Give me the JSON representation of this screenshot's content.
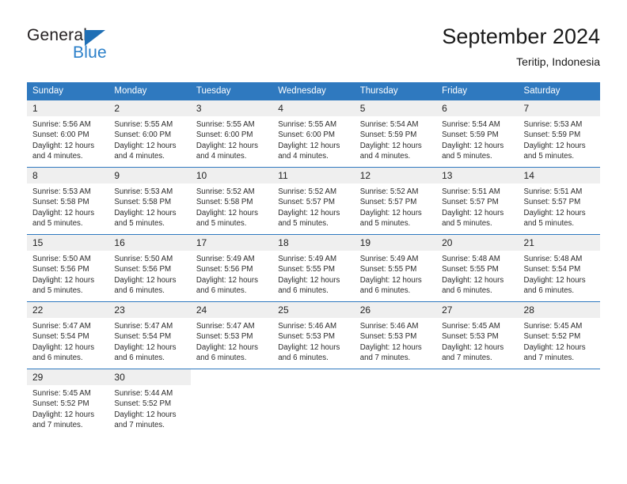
{
  "brand": {
    "name_part1": "General",
    "name_part2": "Blue"
  },
  "header": {
    "title": "September 2024",
    "subtitle": "Teritip, Indonesia"
  },
  "colors": {
    "header_blue": "#2f79bf",
    "daynum_bg": "#efefef",
    "logo_blue": "#2a7fc9",
    "text": "#2b2b2b"
  },
  "weekdays": [
    "Sunday",
    "Monday",
    "Tuesday",
    "Wednesday",
    "Thursday",
    "Friday",
    "Saturday"
  ],
  "weeks": [
    [
      {
        "day": "1",
        "sunrise": "Sunrise: 5:56 AM",
        "sunset": "Sunset: 6:00 PM",
        "daylight1": "Daylight: 12 hours",
        "daylight2": "and 4 minutes."
      },
      {
        "day": "2",
        "sunrise": "Sunrise: 5:55 AM",
        "sunset": "Sunset: 6:00 PM",
        "daylight1": "Daylight: 12 hours",
        "daylight2": "and 4 minutes."
      },
      {
        "day": "3",
        "sunrise": "Sunrise: 5:55 AM",
        "sunset": "Sunset: 6:00 PM",
        "daylight1": "Daylight: 12 hours",
        "daylight2": "and 4 minutes."
      },
      {
        "day": "4",
        "sunrise": "Sunrise: 5:55 AM",
        "sunset": "Sunset: 6:00 PM",
        "daylight1": "Daylight: 12 hours",
        "daylight2": "and 4 minutes."
      },
      {
        "day": "5",
        "sunrise": "Sunrise: 5:54 AM",
        "sunset": "Sunset: 5:59 PM",
        "daylight1": "Daylight: 12 hours",
        "daylight2": "and 4 minutes."
      },
      {
        "day": "6",
        "sunrise": "Sunrise: 5:54 AM",
        "sunset": "Sunset: 5:59 PM",
        "daylight1": "Daylight: 12 hours",
        "daylight2": "and 5 minutes."
      },
      {
        "day": "7",
        "sunrise": "Sunrise: 5:53 AM",
        "sunset": "Sunset: 5:59 PM",
        "daylight1": "Daylight: 12 hours",
        "daylight2": "and 5 minutes."
      }
    ],
    [
      {
        "day": "8",
        "sunrise": "Sunrise: 5:53 AM",
        "sunset": "Sunset: 5:58 PM",
        "daylight1": "Daylight: 12 hours",
        "daylight2": "and 5 minutes."
      },
      {
        "day": "9",
        "sunrise": "Sunrise: 5:53 AM",
        "sunset": "Sunset: 5:58 PM",
        "daylight1": "Daylight: 12 hours",
        "daylight2": "and 5 minutes."
      },
      {
        "day": "10",
        "sunrise": "Sunrise: 5:52 AM",
        "sunset": "Sunset: 5:58 PM",
        "daylight1": "Daylight: 12 hours",
        "daylight2": "and 5 minutes."
      },
      {
        "day": "11",
        "sunrise": "Sunrise: 5:52 AM",
        "sunset": "Sunset: 5:57 PM",
        "daylight1": "Daylight: 12 hours",
        "daylight2": "and 5 minutes."
      },
      {
        "day": "12",
        "sunrise": "Sunrise: 5:52 AM",
        "sunset": "Sunset: 5:57 PM",
        "daylight1": "Daylight: 12 hours",
        "daylight2": "and 5 minutes."
      },
      {
        "day": "13",
        "sunrise": "Sunrise: 5:51 AM",
        "sunset": "Sunset: 5:57 PM",
        "daylight1": "Daylight: 12 hours",
        "daylight2": "and 5 minutes."
      },
      {
        "day": "14",
        "sunrise": "Sunrise: 5:51 AM",
        "sunset": "Sunset: 5:57 PM",
        "daylight1": "Daylight: 12 hours",
        "daylight2": "and 5 minutes."
      }
    ],
    [
      {
        "day": "15",
        "sunrise": "Sunrise: 5:50 AM",
        "sunset": "Sunset: 5:56 PM",
        "daylight1": "Daylight: 12 hours",
        "daylight2": "and 5 minutes."
      },
      {
        "day": "16",
        "sunrise": "Sunrise: 5:50 AM",
        "sunset": "Sunset: 5:56 PM",
        "daylight1": "Daylight: 12 hours",
        "daylight2": "and 6 minutes."
      },
      {
        "day": "17",
        "sunrise": "Sunrise: 5:49 AM",
        "sunset": "Sunset: 5:56 PM",
        "daylight1": "Daylight: 12 hours",
        "daylight2": "and 6 minutes."
      },
      {
        "day": "18",
        "sunrise": "Sunrise: 5:49 AM",
        "sunset": "Sunset: 5:55 PM",
        "daylight1": "Daylight: 12 hours",
        "daylight2": "and 6 minutes."
      },
      {
        "day": "19",
        "sunrise": "Sunrise: 5:49 AM",
        "sunset": "Sunset: 5:55 PM",
        "daylight1": "Daylight: 12 hours",
        "daylight2": "and 6 minutes."
      },
      {
        "day": "20",
        "sunrise": "Sunrise: 5:48 AM",
        "sunset": "Sunset: 5:55 PM",
        "daylight1": "Daylight: 12 hours",
        "daylight2": "and 6 minutes."
      },
      {
        "day": "21",
        "sunrise": "Sunrise: 5:48 AM",
        "sunset": "Sunset: 5:54 PM",
        "daylight1": "Daylight: 12 hours",
        "daylight2": "and 6 minutes."
      }
    ],
    [
      {
        "day": "22",
        "sunrise": "Sunrise: 5:47 AM",
        "sunset": "Sunset: 5:54 PM",
        "daylight1": "Daylight: 12 hours",
        "daylight2": "and 6 minutes."
      },
      {
        "day": "23",
        "sunrise": "Sunrise: 5:47 AM",
        "sunset": "Sunset: 5:54 PM",
        "daylight1": "Daylight: 12 hours",
        "daylight2": "and 6 minutes."
      },
      {
        "day": "24",
        "sunrise": "Sunrise: 5:47 AM",
        "sunset": "Sunset: 5:53 PM",
        "daylight1": "Daylight: 12 hours",
        "daylight2": "and 6 minutes."
      },
      {
        "day": "25",
        "sunrise": "Sunrise: 5:46 AM",
        "sunset": "Sunset: 5:53 PM",
        "daylight1": "Daylight: 12 hours",
        "daylight2": "and 6 minutes."
      },
      {
        "day": "26",
        "sunrise": "Sunrise: 5:46 AM",
        "sunset": "Sunset: 5:53 PM",
        "daylight1": "Daylight: 12 hours",
        "daylight2": "and 7 minutes."
      },
      {
        "day": "27",
        "sunrise": "Sunrise: 5:45 AM",
        "sunset": "Sunset: 5:53 PM",
        "daylight1": "Daylight: 12 hours",
        "daylight2": "and 7 minutes."
      },
      {
        "day": "28",
        "sunrise": "Sunrise: 5:45 AM",
        "sunset": "Sunset: 5:52 PM",
        "daylight1": "Daylight: 12 hours",
        "daylight2": "and 7 minutes."
      }
    ],
    [
      {
        "day": "29",
        "sunrise": "Sunrise: 5:45 AM",
        "sunset": "Sunset: 5:52 PM",
        "daylight1": "Daylight: 12 hours",
        "daylight2": "and 7 minutes."
      },
      {
        "day": "30",
        "sunrise": "Sunrise: 5:44 AM",
        "sunset": "Sunset: 5:52 PM",
        "daylight1": "Daylight: 12 hours",
        "daylight2": "and 7 minutes."
      },
      {
        "day": "",
        "sunrise": "",
        "sunset": "",
        "daylight1": "",
        "daylight2": ""
      },
      {
        "day": "",
        "sunrise": "",
        "sunset": "",
        "daylight1": "",
        "daylight2": ""
      },
      {
        "day": "",
        "sunrise": "",
        "sunset": "",
        "daylight1": "",
        "daylight2": ""
      },
      {
        "day": "",
        "sunrise": "",
        "sunset": "",
        "daylight1": "",
        "daylight2": ""
      },
      {
        "day": "",
        "sunrise": "",
        "sunset": "",
        "daylight1": "",
        "daylight2": ""
      }
    ]
  ]
}
